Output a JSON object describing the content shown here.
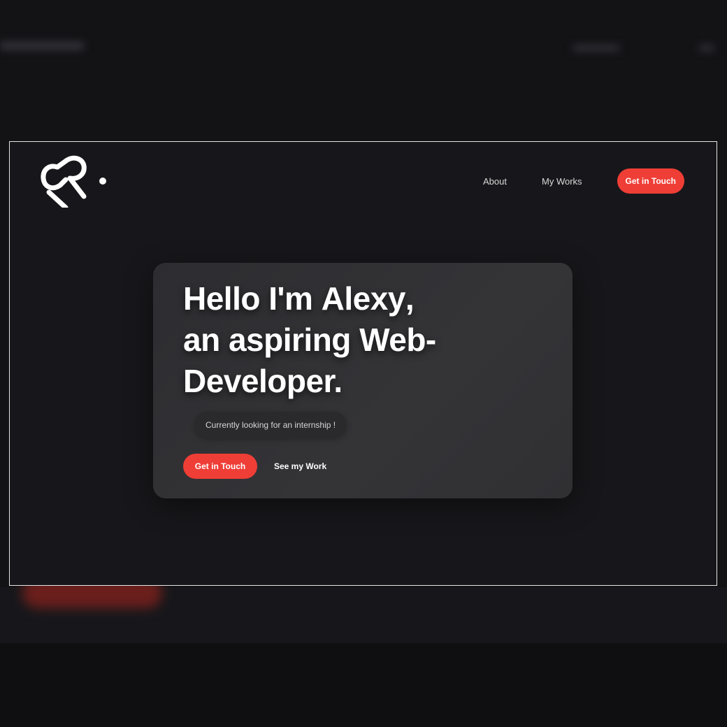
{
  "logo": {
    "icon": "cr-monogram-logo"
  },
  "nav": {
    "links": [
      "About",
      "My Works"
    ],
    "cta": "Get in Touch"
  },
  "hero": {
    "line1_prefix": "Hello I'm ",
    "name": "Alexy",
    "line1_suffix": ",",
    "line2": "an aspiring Web-",
    "line3": "Developer.",
    "tagline": "Currently looking for an internship !",
    "primary_button": "Get in Touch",
    "secondary_button": "See my Work"
  },
  "colors": {
    "accent": "#ef3e36",
    "background": "#17171b",
    "card": "#313134",
    "text": "#ffffff"
  }
}
